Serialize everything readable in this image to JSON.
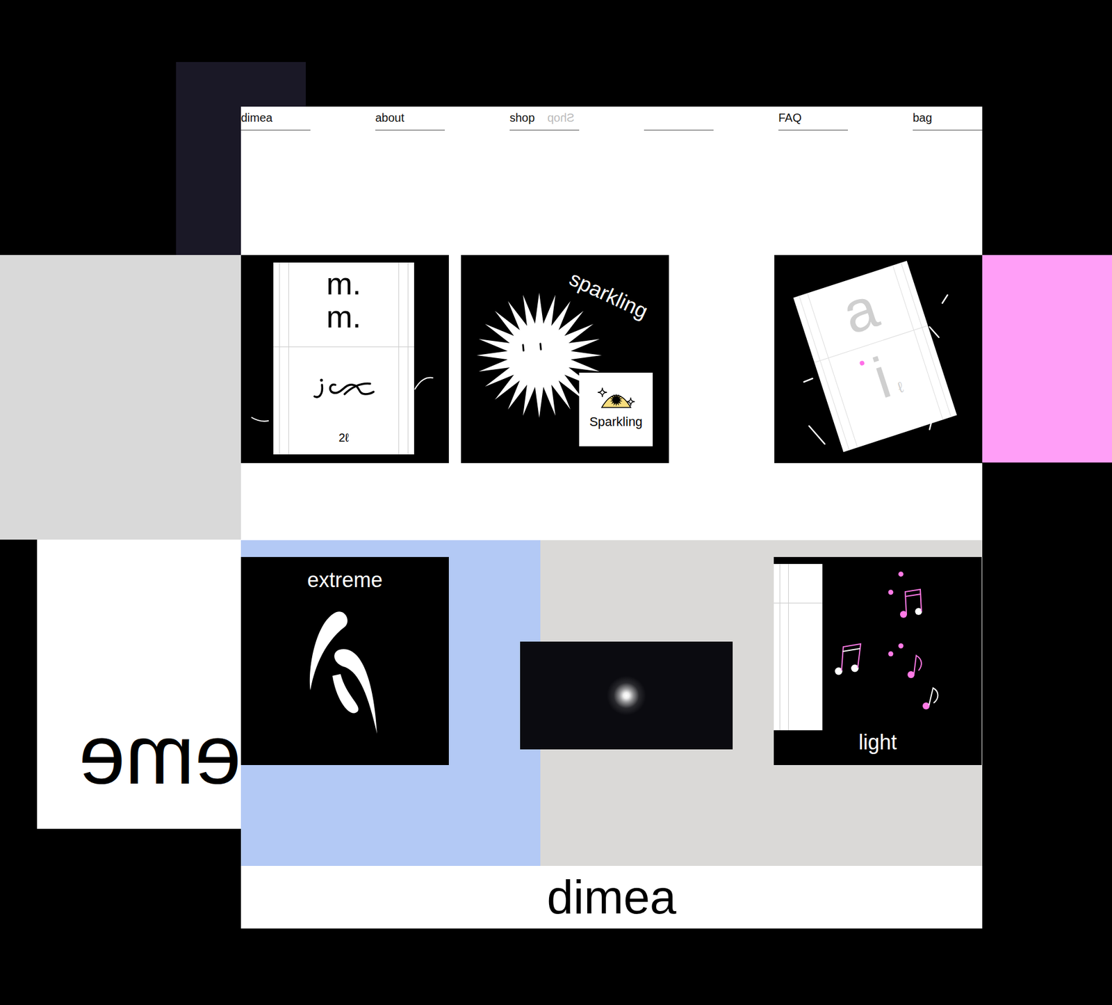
{
  "nav": [
    {
      "kind": "link",
      "label": "dimea"
    },
    {
      "kind": "link",
      "label": "about"
    },
    {
      "kind": "link",
      "label": "shop",
      "mirror": "Shop"
    },
    {
      "kind": "blank"
    },
    {
      "kind": "link",
      "label": "FAQ"
    },
    {
      "kind": "link",
      "label": "bag"
    }
  ],
  "side_word": "eme",
  "featured": [
    {
      "kind": "card",
      "top": [
        "m.",
        "m."
      ],
      "bottom": "2ℓ"
    },
    {
      "kind": "sparkling",
      "title": "sparkling",
      "label": "Sparkling"
    },
    {
      "kind": "letters",
      "letters": [
        "a",
        "i"
      ],
      "small": "ℓ"
    }
  ],
  "lower": [
    {
      "kind": "extreme",
      "title": "extreme"
    },
    {
      "kind": "glow"
    },
    {
      "kind": "light",
      "title": "light"
    }
  ],
  "footer": "dimea"
}
